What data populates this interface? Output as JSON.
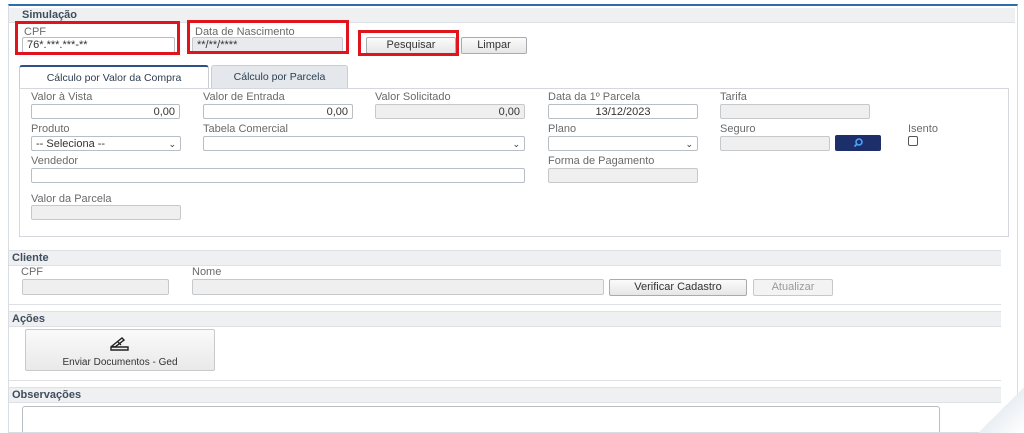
{
  "simulacao": {
    "title": "Simulação",
    "cpf_label": "CPF",
    "cpf_value": "76*.***.***-**",
    "nascimento_label": "Data de Nascimento",
    "nascimento_value": "**/**/****",
    "pesquisar_label": "Pesquisar",
    "limpar_label": "Limpar"
  },
  "tabs": [
    {
      "label": "Cálculo por Valor da Compra",
      "active": true
    },
    {
      "label": "Cálculo por Parcela",
      "active": false
    }
  ],
  "form": {
    "valor_vista_label": "Valor à Vista",
    "valor_vista_value": "0,00",
    "valor_entrada_label": "Valor de Entrada",
    "valor_entrada_value": "0,00",
    "valor_solicitado_label": "Valor Solicitado",
    "valor_solicitado_value": "0,00",
    "data_parcela_label": "Data da 1º Parcela",
    "data_parcela_value": "13/12/2023",
    "tarifa_label": "Tarifa",
    "produto_label": "Produto",
    "produto_value": "-- Seleciona --",
    "tabela_label": "Tabela Comercial",
    "tabela_value": "",
    "plano_label": "Plano",
    "plano_value": "",
    "seguro_label": "Seguro",
    "isento_label": "Isento",
    "vendedor_label": "Vendedor",
    "forma_pagamento_label": "Forma de Pagamento",
    "valor_parcela_label": "Valor da Parcela"
  },
  "cliente": {
    "title": "Cliente",
    "cpf_label": "CPF",
    "nome_label": "Nome",
    "verificar_label": "Verificar Cadastro",
    "atualizar_label": "Atualizar"
  },
  "acoes": {
    "title": "Ações",
    "enviar_label": "Enviar Documentos - Ged"
  },
  "observacoes": {
    "title": "Observações"
  },
  "colors": {
    "accent": "#2f6ea9",
    "highlight": "#e0141c",
    "search_button": "#1d2f6b"
  },
  "icons": {
    "search": "search-icon",
    "scanner": "scanner-icon",
    "chevron": "chevron-down-icon"
  }
}
